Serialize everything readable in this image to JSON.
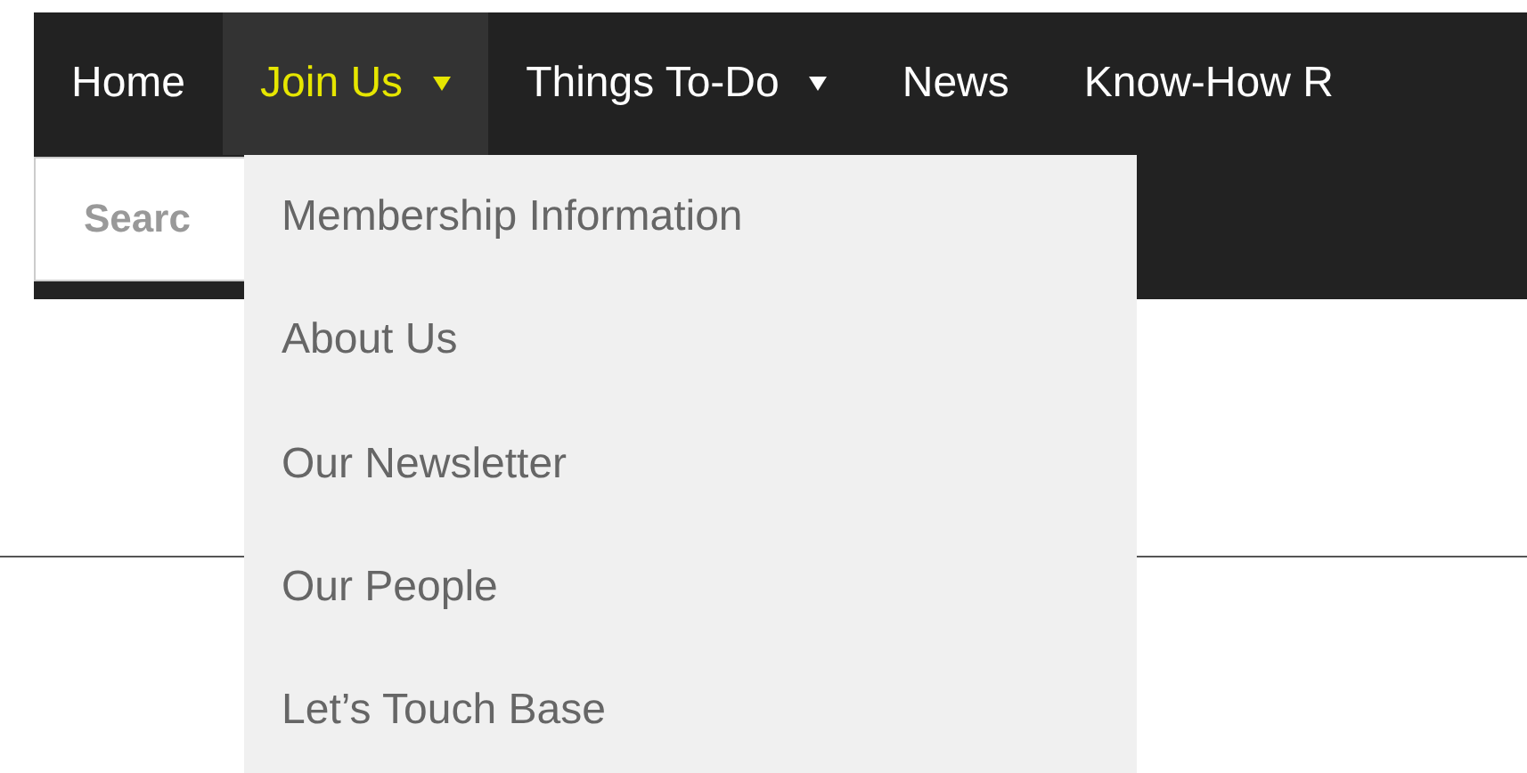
{
  "nav": {
    "items": [
      {
        "label": "Home",
        "selected": false,
        "has_submenu": false
      },
      {
        "label": "Join Us",
        "selected": true,
        "has_submenu": true,
        "expanded": true,
        "submenu": [
          "Membership Information",
          "About Us",
          "Our Newsletter",
          "Our People",
          "Let’s Touch Base"
        ]
      },
      {
        "label": "Things To-Do",
        "selected": false,
        "has_submenu": true
      },
      {
        "label": "News",
        "selected": false,
        "has_submenu": false
      },
      {
        "label": "Know-How R",
        "selected": false,
        "has_submenu": false
      }
    ]
  },
  "search": {
    "placeholder": "Searc"
  }
}
